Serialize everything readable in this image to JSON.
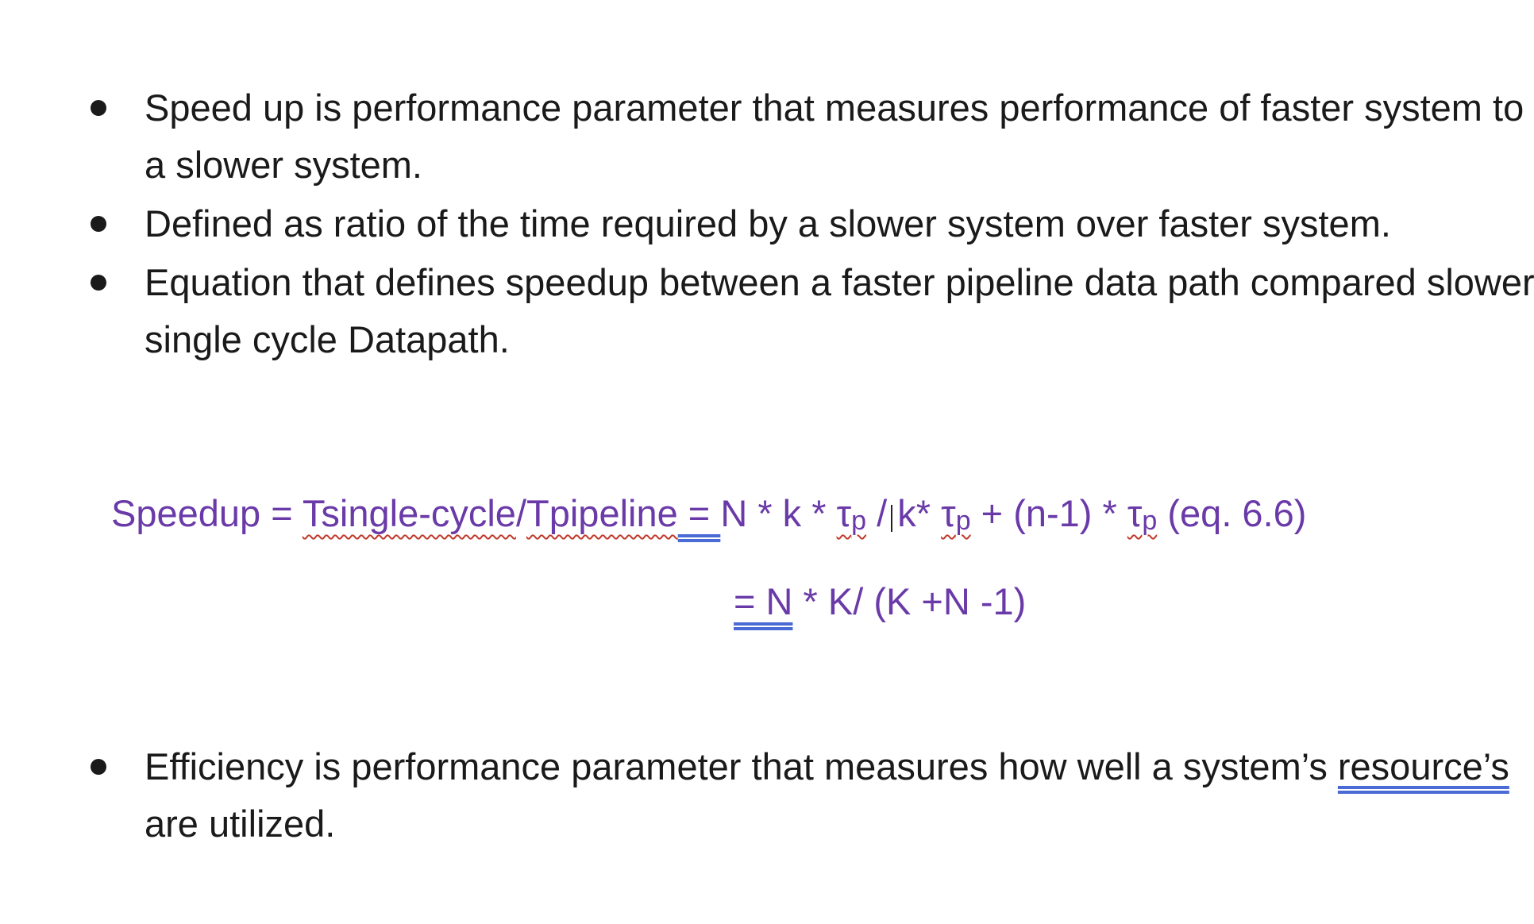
{
  "bullets_top": [
    {
      "text": "Speed up is performance parameter that measures performance of faster system to a slower system."
    },
    {
      "text": "Defined as ratio of the time required by a slower system over faster system."
    },
    {
      "text": "Equation that defines speedup between a faster pipeline data path compared slower single cycle Datapath."
    }
  ],
  "equation": {
    "speedup": "Speedup",
    "equals1": " = ",
    "tsingle": "Tsingle-cycle",
    "slash": "/",
    "tpipeline": "Tpipeline",
    "equals2": " = ",
    "n_k": "N * k * ",
    "tau1": "τ",
    "p1": "p",
    "div_k": " / k* ",
    "tau2": "τ",
    "p2": "p",
    "plus": " + (n-1) * ",
    "tau3": "τ",
    "p3": "p",
    "eq_ref": "  (eq. 6.6)",
    "line2_equals": "=  N",
    "line2_rest": " * K/ (K +N -1)"
  },
  "bullets_bottom": [
    {
      "text_before": "Efficiency is performance parameter that measures how well a system’s ",
      "underlined": "resource’s",
      "text_after": " are utilized."
    }
  ],
  "colors": {
    "equation": "#6a3aa8",
    "body_text": "#1a1a1a",
    "spellcheck": "#c0392b",
    "grammar": "#4a6bd6"
  }
}
